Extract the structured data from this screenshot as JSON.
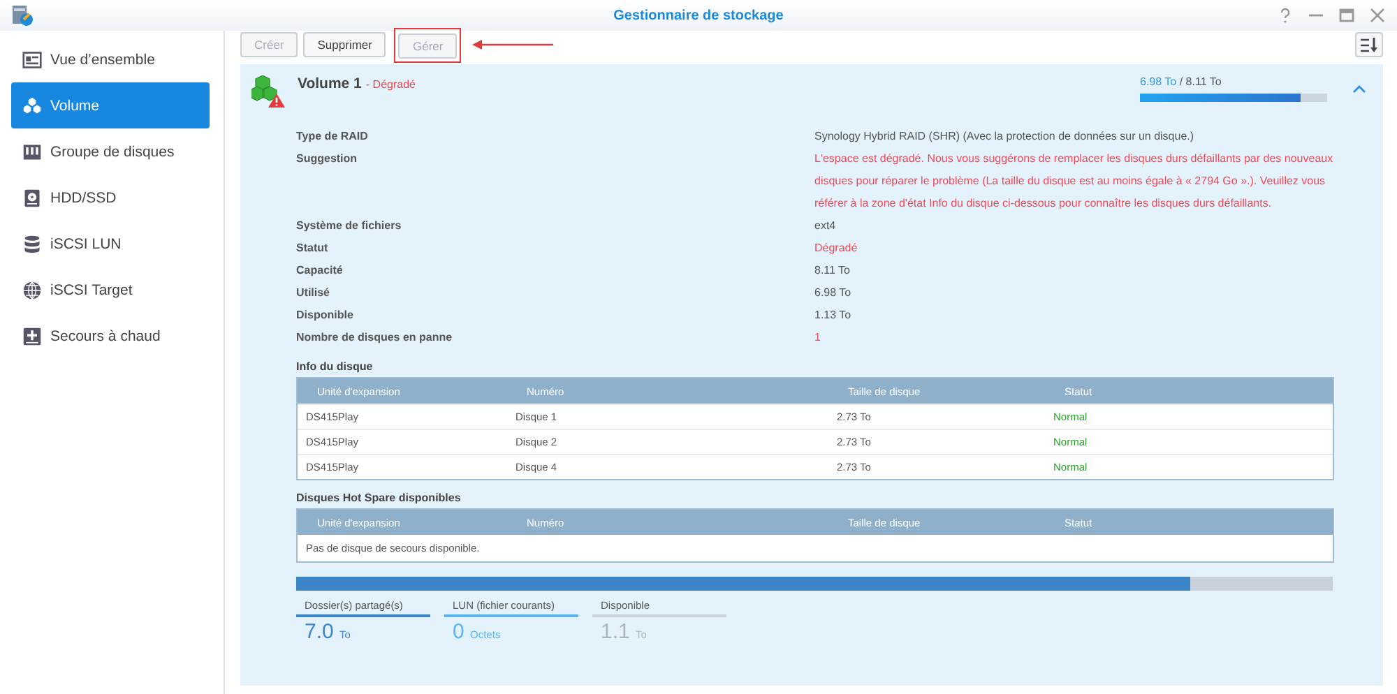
{
  "window": {
    "title": "Gestionnaire de stockage"
  },
  "sidebar": {
    "items": [
      {
        "label": "Vue d’ensemble",
        "selected": false
      },
      {
        "label": "Volume",
        "selected": true
      },
      {
        "label": "Groupe de disques",
        "selected": false
      },
      {
        "label": "HDD/SSD",
        "selected": false
      },
      {
        "label": "iSCSI LUN",
        "selected": false
      },
      {
        "label": "iSCSI Target",
        "selected": false
      },
      {
        "label": "Secours à chaud",
        "selected": false
      }
    ]
  },
  "toolbar": {
    "buttons": [
      {
        "label": "Créer",
        "disabled": true,
        "highlighted": false
      },
      {
        "label": "Supprimer",
        "disabled": false,
        "highlighted": false
      },
      {
        "label": "Gérer",
        "disabled": true,
        "highlighted": true
      }
    ]
  },
  "volume": {
    "name": "Volume 1",
    "status": "- Dégradé",
    "used": "6.98 To",
    "total": "/ 8.11 To",
    "level": 0.86,
    "expanded": true,
    "details": [
      {
        "label": "Type de RAID",
        "value": "Synology Hybrid RAID (SHR) (Avec la protection de données sur un disque.)",
        "alert": false
      },
      {
        "label": "Suggestion",
        "value": "L'espace est dégradé. Nous vous suggérons de remplacer les disques durs défaillants par des nouveaux disques pour réparer le problème (La taille du disque est au moins égale à « 2794 Go ».). Veuillez vous référer à la zone d'état Info du disque ci-dessous pour connaître les disques durs défaillants.",
        "alert": true
      },
      {
        "label": "Système de fichiers",
        "value": "ext4",
        "alert": false
      },
      {
        "label": "Statut",
        "value": "Dégradé",
        "alert": true
      },
      {
        "label": "Capacité",
        "value": "8.11 To",
        "alert": false
      },
      {
        "label": "Utilisé",
        "value": "6.98 To",
        "alert": false
      },
      {
        "label": "Disponible",
        "value": "1.13 To",
        "alert": false
      },
      {
        "label": "Nombre de disques en panne",
        "value": "1",
        "alert": true
      }
    ],
    "disk_info": {
      "title": "Info du disque",
      "columns": [
        "Unité d'expansion",
        "Numéro",
        "Taille de disque",
        "Statut"
      ],
      "rows": [
        {
          "cells": [
            "DS415Play",
            "Disque 1",
            "2.73 To",
            "Normal"
          ],
          "healthy": true
        },
        {
          "cells": [
            "DS415Play",
            "Disque 2",
            "2.73 To",
            "Normal"
          ],
          "healthy": true
        },
        {
          "cells": [
            "DS415Play",
            "Disque 4",
            "2.73 To",
            "Normal"
          ],
          "healthy": true
        }
      ]
    },
    "hot_spare": {
      "title": "Disques Hot Spare disponibles",
      "columns": [
        "Unité d'expansion",
        "Numéro",
        "Taille de disque",
        "Statut"
      ],
      "empty_message": "Pas de disque de secours disponible."
    },
    "storage": [
      {
        "label": "Dossier(s) partagé(s)",
        "value": "7.0",
        "unit": "To",
        "level": 0.863,
        "color": "#3d85c9"
      },
      {
        "label": "LUN (fichier courants)",
        "value": "0",
        "unit": "Octets",
        "color": "#5ab4ef"
      },
      {
        "label": "Disponible",
        "value": "1.1",
        "unit": "To",
        "level": 0.137,
        "color": "#c9d2dc"
      }
    ]
  }
}
